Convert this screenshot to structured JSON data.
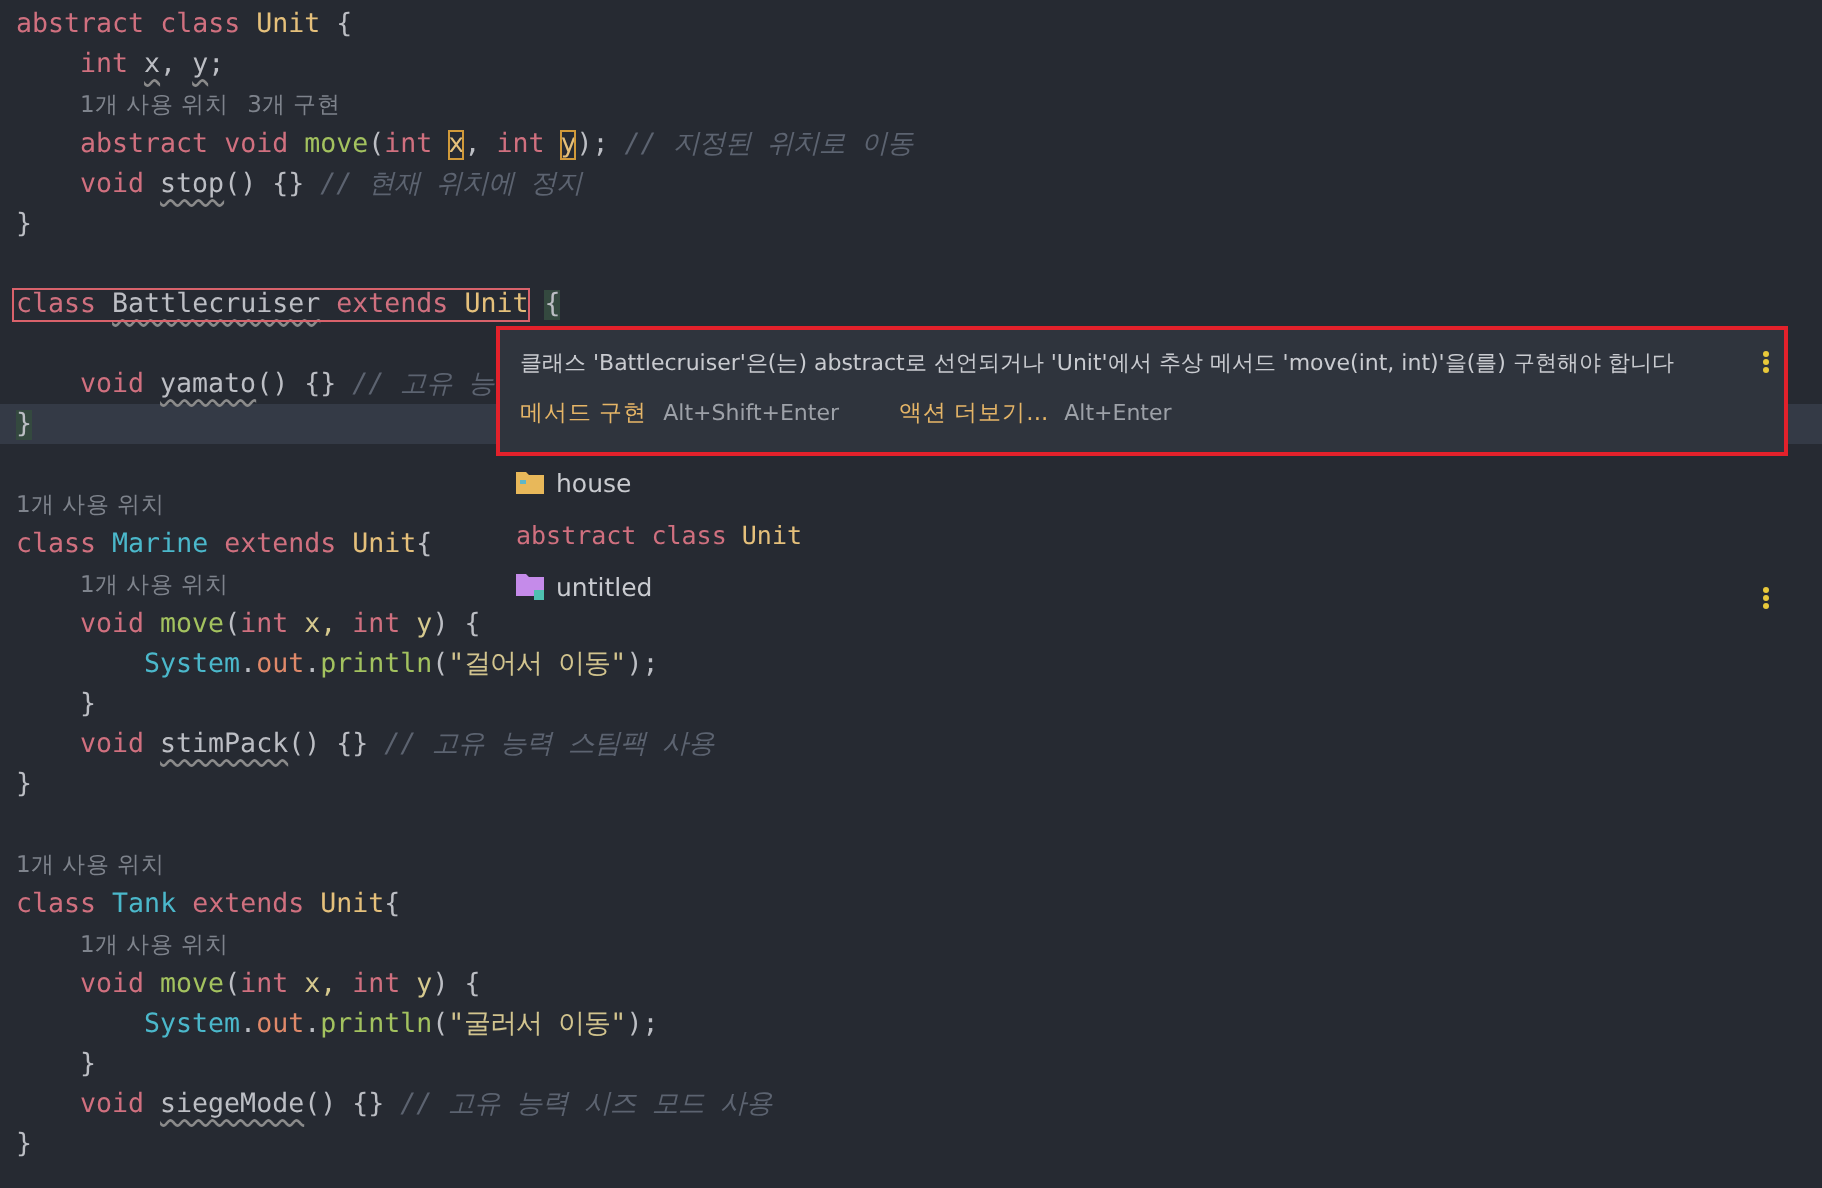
{
  "editor": {
    "lines": [
      {
        "kind": "code",
        "current": false,
        "tokens": [
          {
            "kind": "keyword",
            "text": "abstract "
          },
          {
            "kind": "keyword",
            "text": "class "
          },
          {
            "kind": "type",
            "text": "Unit "
          },
          {
            "kind": "plain",
            "text": "{"
          }
        ],
        "children": [
          {
            "kind": "code",
            "current": false,
            "tokens": [
              {
                "kind": "keyword",
                "text": "int "
              },
              {
                "kind": "warn",
                "text": "x"
              },
              {
                "kind": "plain",
                "text": ", "
              },
              {
                "kind": "warn",
                "text": "y"
              },
              {
                "kind": "plain",
                "text": ";"
              }
            ]
          },
          {
            "kind": "hint",
            "hints": [
              "1개 사용 위치",
              "3개 구현"
            ]
          },
          {
            "kind": "code",
            "current": false,
            "tokens": [
              {
                "kind": "keyword",
                "text": "abstract "
              },
              {
                "kind": "keyword",
                "text": "void "
              },
              {
                "kind": "method",
                "text": "move"
              },
              {
                "kind": "plain",
                "text": "("
              },
              {
                "kind": "keyword",
                "text": "int "
              },
              {
                "kind": "boxed",
                "text": "x"
              },
              {
                "kind": "plain",
                "text": ", "
              },
              {
                "kind": "keyword",
                "text": "int "
              },
              {
                "kind": "boxed",
                "text": "y"
              },
              {
                "kind": "plain",
                "text": "); "
              },
              {
                "kind": "comment",
                "text": "// 지정된 위치로 이동"
              }
            ]
          },
          {
            "kind": "code",
            "current": false,
            "tokens": [
              {
                "kind": "keyword",
                "text": "void "
              },
              {
                "kind": "warn",
                "text": "stop"
              },
              {
                "kind": "plain",
                "text": "() {} "
              },
              {
                "kind": "comment",
                "text": "// 현재 위치에 정지"
              }
            ]
          }
        ]
      },
      {
        "kind": "code",
        "current": false,
        "tokens": [
          {
            "kind": "plain",
            "text": "}"
          }
        ]
      },
      {
        "kind": "blank"
      },
      {
        "kind": "code",
        "current": false,
        "boxed_tokens": [
          {
            "kind": "keyword",
            "text": "class "
          },
          {
            "kind": "warn",
            "text": "Battlecruiser"
          },
          {
            "kind": "keyword",
            "text": " extends "
          },
          {
            "kind": "type",
            "text": "Unit"
          }
        ],
        "tokens": [
          {
            "kind": "brace",
            "text": "{"
          }
        ],
        "children": [
          {
            "kind": "blank"
          },
          {
            "kind": "code",
            "current": false,
            "tokens": [
              {
                "kind": "keyword",
                "text": "void "
              },
              {
                "kind": "warn",
                "text": "yamato"
              },
              {
                "kind": "plain",
                "text": "() {} "
              },
              {
                "kind": "comment",
                "text": "// 고유 능"
              }
            ]
          }
        ]
      },
      {
        "kind": "code",
        "current": true,
        "tokens": [
          {
            "kind": "brace",
            "text": "}"
          }
        ]
      },
      {
        "kind": "blank"
      },
      {
        "kind": "hint",
        "hints": [
          "1개 사용 위치"
        ]
      },
      {
        "kind": "code",
        "current": false,
        "tokens": [
          {
            "kind": "keyword",
            "text": "class "
          },
          {
            "kind": "classname",
            "text": "Marine "
          },
          {
            "kind": "keyword",
            "text": "extends "
          },
          {
            "kind": "type",
            "text": "Unit"
          },
          {
            "kind": "plain",
            "text": "{"
          }
        ],
        "children": [
          {
            "kind": "hint",
            "hints": [
              "1개 사용 위치"
            ]
          },
          {
            "kind": "code",
            "current": false,
            "tokens": [
              {
                "kind": "keyword",
                "text": "void "
              },
              {
                "kind": "method",
                "text": "move"
              },
              {
                "kind": "plain",
                "text": "("
              },
              {
                "kind": "keyword",
                "text": "int "
              },
              {
                "kind": "param",
                "text": "x, "
              },
              {
                "kind": "keyword",
                "text": "int "
              },
              {
                "kind": "param",
                "text": "y"
              },
              {
                "kind": "plain",
                "text": ") {"
              }
            ],
            "children": [
              {
                "kind": "code",
                "current": false,
                "tokens": [
                  {
                    "kind": "classname",
                    "text": "System"
                  },
                  {
                    "kind": "plain",
                    "text": "."
                  },
                  {
                    "kind": "field",
                    "text": "out"
                  },
                  {
                    "kind": "plain",
                    "text": "."
                  },
                  {
                    "kind": "method",
                    "text": "println"
                  },
                  {
                    "kind": "plain",
                    "text": "("
                  },
                  {
                    "kind": "string",
                    "text": "\"걸어서 이동\""
                  },
                  {
                    "kind": "plain",
                    "text": ");"
                  }
                ]
              }
            ]
          },
          {
            "kind": "code",
            "current": false,
            "tokens": [
              {
                "kind": "plain",
                "text": "}"
              }
            ]
          },
          {
            "kind": "code",
            "current": false,
            "tokens": [
              {
                "kind": "keyword",
                "text": "void "
              },
              {
                "kind": "warn",
                "text": "stimPack"
              },
              {
                "kind": "plain",
                "text": "() {} "
              },
              {
                "kind": "comment",
                "text": "// 고유 능력 스팀팩 사용"
              }
            ]
          }
        ]
      },
      {
        "kind": "code",
        "current": false,
        "tokens": [
          {
            "kind": "plain",
            "text": "}"
          }
        ]
      },
      {
        "kind": "blank"
      },
      {
        "kind": "hint",
        "hints": [
          "1개 사용 위치"
        ]
      },
      {
        "kind": "code",
        "current": false,
        "tokens": [
          {
            "kind": "keyword",
            "text": "class "
          },
          {
            "kind": "classname",
            "text": "Tank "
          },
          {
            "kind": "keyword",
            "text": "extends "
          },
          {
            "kind": "type",
            "text": "Unit"
          },
          {
            "kind": "plain",
            "text": "{"
          }
        ],
        "children": [
          {
            "kind": "hint",
            "hints": [
              "1개 사용 위치"
            ]
          },
          {
            "kind": "code",
            "current": false,
            "tokens": [
              {
                "kind": "keyword",
                "text": "void "
              },
              {
                "kind": "method",
                "text": "move"
              },
              {
                "kind": "plain",
                "text": "("
              },
              {
                "kind": "keyword",
                "text": "int "
              },
              {
                "kind": "param",
                "text": "x, "
              },
              {
                "kind": "keyword",
                "text": "int "
              },
              {
                "kind": "param",
                "text": "y"
              },
              {
                "kind": "plain",
                "text": ") {"
              }
            ],
            "children": [
              {
                "kind": "code",
                "current": false,
                "tokens": [
                  {
                    "kind": "classname",
                    "text": "System"
                  },
                  {
                    "kind": "plain",
                    "text": "."
                  },
                  {
                    "kind": "field",
                    "text": "out"
                  },
                  {
                    "kind": "plain",
                    "text": "."
                  },
                  {
                    "kind": "method",
                    "text": "println"
                  },
                  {
                    "kind": "plain",
                    "text": "("
                  },
                  {
                    "kind": "string",
                    "text": "\"굴러서 이동\""
                  },
                  {
                    "kind": "plain",
                    "text": ");"
                  }
                ]
              }
            ]
          },
          {
            "kind": "code",
            "current": false,
            "tokens": [
              {
                "kind": "plain",
                "text": "}"
              }
            ]
          },
          {
            "kind": "code",
            "current": false,
            "tokens": [
              {
                "kind": "keyword",
                "text": "void "
              },
              {
                "kind": "warn",
                "text": "siegeMode"
              },
              {
                "kind": "plain",
                "text": "() {} "
              },
              {
                "kind": "comment",
                "text": "// 고유 능력 시즈 모드 사용"
              }
            ]
          }
        ]
      },
      {
        "kind": "code",
        "current": false,
        "tokens": [
          {
            "kind": "plain",
            "text": "}"
          }
        ]
      }
    ]
  },
  "error_popup": {
    "message": "클래스 'Battlecruiser'은(는) abstract로 선언되거나 'Unit'에서 추상 메서드 'move(int, int)'을(를) 구현해야 합니다",
    "actions": [
      {
        "label": "메서드 구현",
        "shortcut": "Alt+Shift+Enter"
      },
      {
        "label": "액션 더보기...",
        "shortcut": "Alt+Enter"
      }
    ]
  },
  "context_list": {
    "items": [
      {
        "kind": "folder",
        "label": "house"
      },
      {
        "kind": "class",
        "tokens": [
          {
            "kind": "keyword",
            "text": "abstract "
          },
          {
            "kind": "keyword",
            "text": "class "
          },
          {
            "kind": "type",
            "text": "Unit"
          }
        ]
      },
      {
        "kind": "module",
        "label": "untitled"
      }
    ]
  }
}
